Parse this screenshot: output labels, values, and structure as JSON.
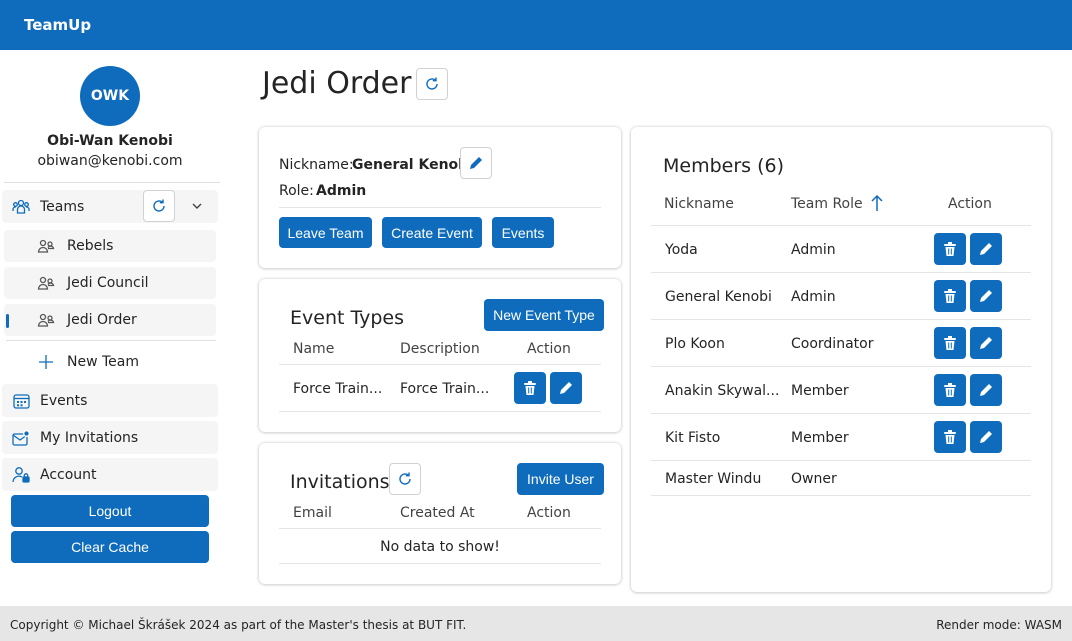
{
  "app": {
    "brand": "TeamUp"
  },
  "colors": {
    "accent": "#0f6cbd",
    "footer_bg": "#e6e6e6"
  },
  "user": {
    "initials": "OWK",
    "name": "Obi-Wan Kenobi",
    "email": "obiwan@kenobi.com"
  },
  "sidebar": {
    "teams_label": "Teams",
    "teams": [
      {
        "label": "Rebels",
        "icon": "people-icon"
      },
      {
        "label": "Jedi Council",
        "icon": "people-icon"
      },
      {
        "label": "Jedi Order",
        "icon": "people-icon",
        "active": true
      }
    ],
    "new_team_label": "New Team",
    "events_label": "Events",
    "invitations_label": "My Invitations",
    "account_label": "Account",
    "logout_label": "Logout",
    "clear_cache_label": "Clear Cache"
  },
  "page": {
    "title": "Jedi Order"
  },
  "team_info": {
    "nickname_label": "Nickname:",
    "nickname_value": "General Kenobi",
    "role_label": "Role:",
    "role_value": "Admin",
    "leave_label": "Leave Team",
    "create_event_label": "Create Event",
    "events_label": "Events"
  },
  "event_types": {
    "title": "Event Types",
    "new_button": "New Event Type",
    "columns": [
      "Name",
      "Description",
      "Action"
    ],
    "rows": [
      {
        "name": "Force Train...",
        "description": "Force Train..."
      }
    ]
  },
  "invitations": {
    "title": "Invitations",
    "invite_button": "Invite User",
    "columns": [
      "Email",
      "Created At",
      "Action"
    ],
    "empty_text": "No data to show!"
  },
  "members": {
    "title": "Members (6)",
    "columns": [
      "Nickname",
      "Team Role",
      "Action"
    ],
    "sort_icon": "arrow-up-icon",
    "rows": [
      {
        "nickname": "Yoda",
        "role": "Admin"
      },
      {
        "nickname": "General Kenobi",
        "role": "Admin"
      },
      {
        "nickname": "Plo Koon",
        "role": "Coordinator"
      },
      {
        "nickname": "Anakin Skywal...",
        "role": "Member"
      },
      {
        "nickname": "Kit Fisto",
        "role": "Member"
      },
      {
        "nickname": "Master Windu",
        "role": "Owner"
      }
    ]
  },
  "footer": {
    "copyright": "Copyright © Michael Škrášek 2024 as part of the Master's thesis at BUT FIT.",
    "render_mode": "Render mode: WASM"
  }
}
